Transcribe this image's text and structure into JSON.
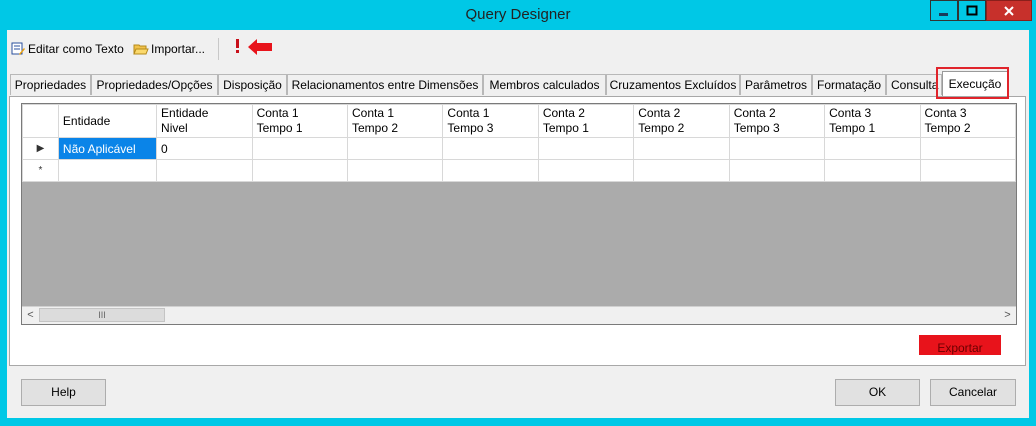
{
  "window": {
    "title": "Query Designer"
  },
  "toolbar": {
    "edit_as_text": "Editar como Texto",
    "import": "Importar..."
  },
  "tabs": [
    "Propriedades",
    "Propriedades/Opções",
    "Disposição",
    "Relacionamentos entre Dimensões",
    "Membros calculados",
    "Cruzamentos Excluídos",
    "Parâmetros",
    "Formatação",
    "Consulta",
    "Execução"
  ],
  "active_tab": "Execução",
  "grid": {
    "columns": [
      {
        "l1": "Entidade",
        "l2": ""
      },
      {
        "l1": "Entidade",
        "l2": "Nivel"
      },
      {
        "l1": "Conta 1",
        "l2": "Tempo 1"
      },
      {
        "l1": "Conta 1",
        "l2": "Tempo 2"
      },
      {
        "l1": "Conta 1",
        "l2": "Tempo 3"
      },
      {
        "l1": "Conta 2",
        "l2": "Tempo 1"
      },
      {
        "l1": "Conta 2",
        "l2": "Tempo 2"
      },
      {
        "l1": "Conta 2",
        "l2": "Tempo 3"
      },
      {
        "l1": "Conta 3",
        "l2": "Tempo 1"
      },
      {
        "l1": "Conta 3",
        "l2": "Tempo 2"
      }
    ],
    "rows": [
      {
        "indicator": "▶",
        "cells": [
          "Não Aplicável",
          "0",
          "",
          "",
          "",
          "",
          "",
          "",
          "",
          ""
        ]
      },
      {
        "indicator": "*",
        "cells": [
          "",
          "",
          "",
          "",
          "",
          "",
          "",
          "",
          "",
          ""
        ]
      }
    ]
  },
  "buttons": {
    "export": "Exportar",
    "help": "Help",
    "ok": "OK",
    "cancel": "Cancelar"
  },
  "colors": {
    "frame": "#00c8e6",
    "highlight": "#e0242b",
    "selection": "#0a84e8",
    "export": "#e8131b"
  }
}
